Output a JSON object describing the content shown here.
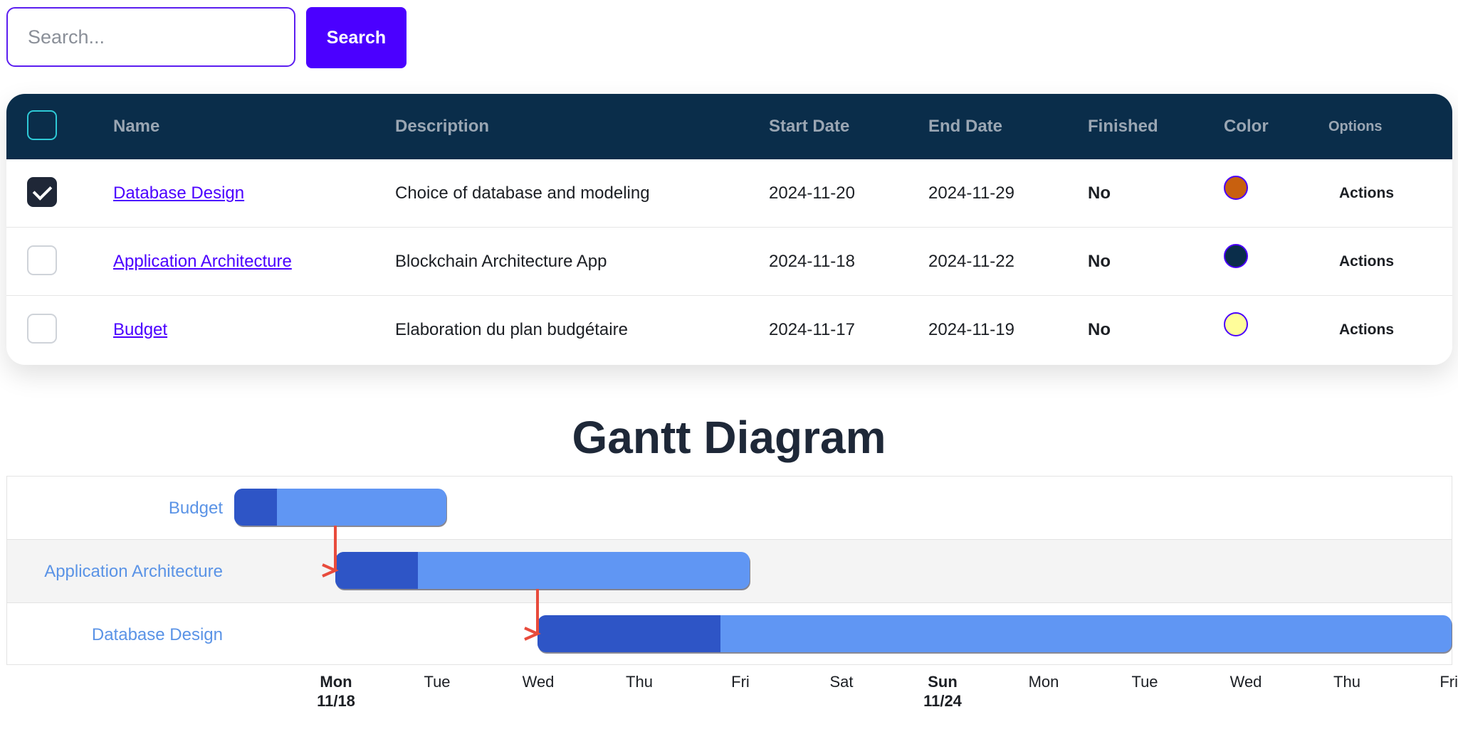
{
  "search": {
    "placeholder": "Search...",
    "button_label": "Search"
  },
  "table": {
    "headers": {
      "name": "Name",
      "description": "Description",
      "start_date": "Start Date",
      "end_date": "End Date",
      "finished": "Finished",
      "color": "Color",
      "options": "Options"
    },
    "rows": [
      {
        "checked": true,
        "name": "Database Design",
        "description": "Choice of database and modeling",
        "start_date": "2024-11-20",
        "end_date": "2024-11-29",
        "finished": "No",
        "color": "#c8600f",
        "actions": "Actions"
      },
      {
        "checked": false,
        "name": "Application Architecture",
        "description": "Blockchain Architecture App",
        "start_date": "2024-11-18",
        "end_date": "2024-11-22",
        "finished": "No",
        "color": "#0a2d4a",
        "actions": "Actions"
      },
      {
        "checked": false,
        "name": "Budget",
        "description": "Elaboration du plan budgétaire",
        "start_date": "2024-11-17",
        "end_date": "2024-11-19",
        "finished": "No",
        "color": "#fffd9a",
        "actions": "Actions"
      }
    ]
  },
  "gantt": {
    "title": "Gantt Diagram",
    "colors": {
      "bar": "#6096f3",
      "progress": "#2e55c6",
      "dependency": "#e84b3c",
      "label": "#5a93e6"
    },
    "tasks": [
      {
        "name": "Budget",
        "start": "2024-11-17",
        "end": "2024-11-19",
        "progress": 0.2
      },
      {
        "name": "Application Architecture",
        "start": "2024-11-18",
        "end": "2024-11-22",
        "progress": 0.2,
        "depends_on": "Budget"
      },
      {
        "name": "Database Design",
        "start": "2024-11-20",
        "end": "2024-11-29",
        "progress": 0.2,
        "depends_on": "Application Architecture"
      }
    ],
    "axis_ticks": [
      {
        "day": "Mon",
        "date": "11/18",
        "major": true
      },
      {
        "day": "Tue",
        "date": "",
        "major": false
      },
      {
        "day": "Wed",
        "date": "",
        "major": false
      },
      {
        "day": "Thu",
        "date": "",
        "major": false
      },
      {
        "day": "Fri",
        "date": "",
        "major": false
      },
      {
        "day": "Sat",
        "date": "",
        "major": false
      },
      {
        "day": "Sun",
        "date": "11/24",
        "major": true
      },
      {
        "day": "Mon",
        "date": "",
        "major": false
      },
      {
        "day": "Tue",
        "date": "",
        "major": false
      },
      {
        "day": "Wed",
        "date": "",
        "major": false
      },
      {
        "day": "Thu",
        "date": "",
        "major": false
      },
      {
        "day": "Fri",
        "date": "",
        "major": false
      }
    ]
  }
}
